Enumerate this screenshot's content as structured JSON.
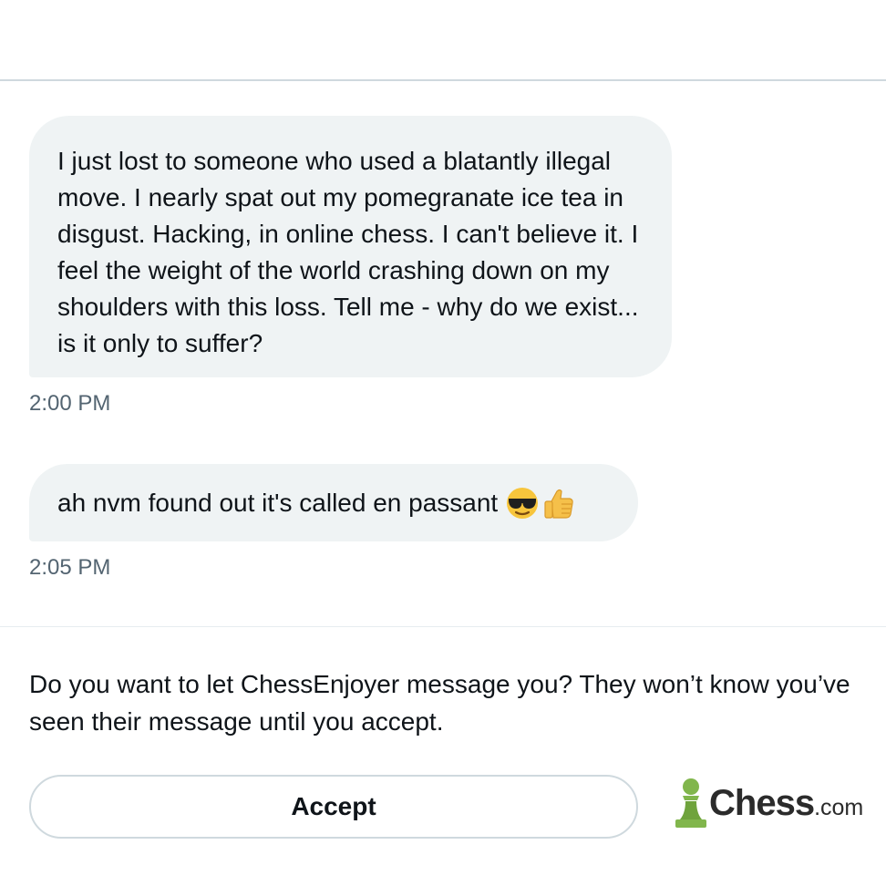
{
  "thread": {
    "messages": [
      {
        "text": "I just lost to someone who used a blatantly illegal move. I nearly spat out my pomegranate ice tea in disgust. Hacking, in online chess. I can't believe it. I feel the weight of the world crashing down on my shoulders with this loss. Tell me - why do we exist... is it only to suffer?",
        "time": "2:00 PM"
      },
      {
        "text": "ah nvm found out it's called en passant",
        "emojis": [
          "sunglasses-face-icon",
          "thumbs-up-icon"
        ],
        "time": "2:05 PM"
      }
    ]
  },
  "request": {
    "prompt": "Do you want to let  ChessEnjoyer message  you? They won’t know you’ve seen their message until you accept.",
    "accept_label": "Accept"
  },
  "logo": {
    "name": "Chess",
    "suffix": ".com",
    "pawn_color": "#81b64c"
  },
  "colors": {
    "bubble_bg": "#eff3f4",
    "timestamp": "#536471",
    "border": "#cfd9de"
  }
}
